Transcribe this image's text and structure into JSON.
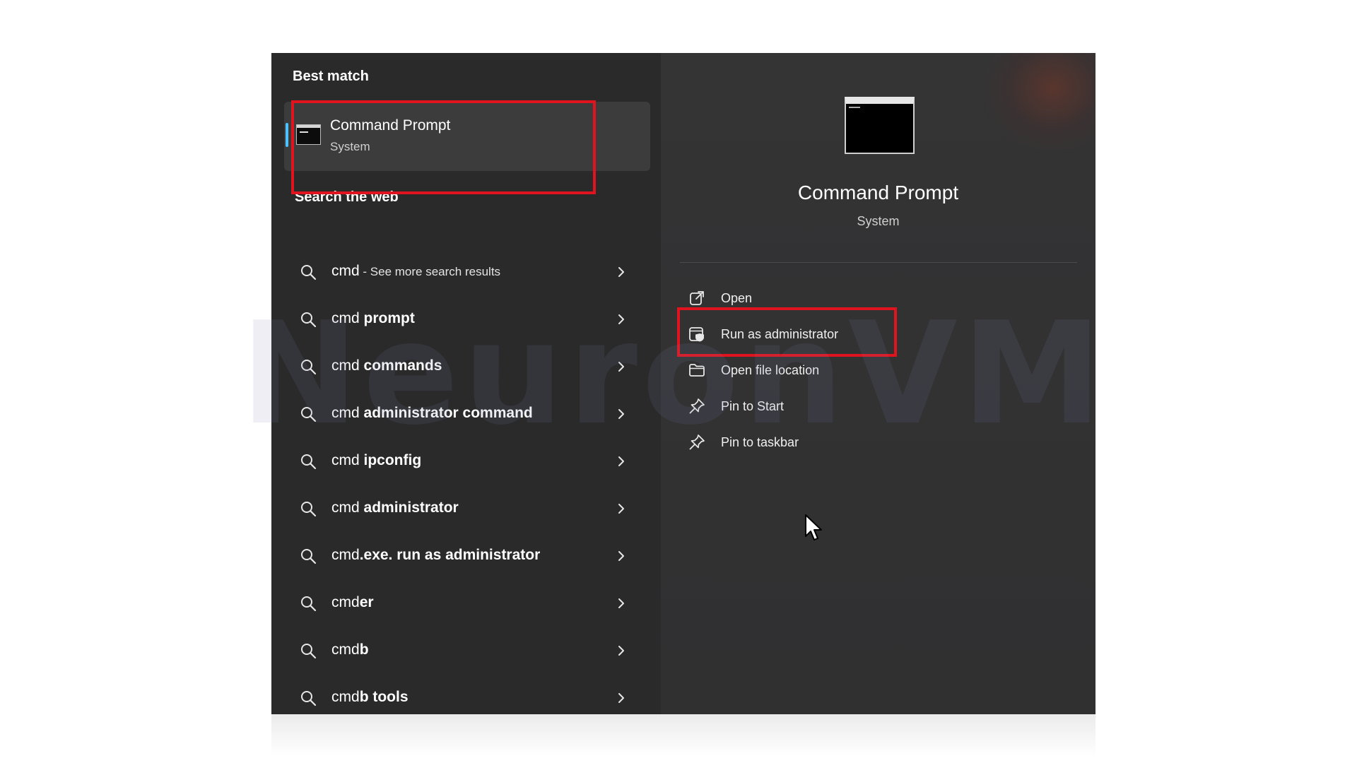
{
  "left": {
    "best_match_title": "Best match",
    "best_match": {
      "name": "Command Prompt",
      "subtitle": "System",
      "icon": "cmd-icon"
    },
    "search_web_title": "Search the web",
    "web_results": [
      {
        "prefix": "cmd",
        "bold": "",
        "note": " - See more search results",
        "icon": "search-icon"
      },
      {
        "prefix": "cmd ",
        "bold": "prompt",
        "note": "",
        "icon": "search-icon"
      },
      {
        "prefix": "cmd ",
        "bold": "commands",
        "note": "",
        "icon": "search-icon"
      },
      {
        "prefix": "cmd ",
        "bold": "administrator command",
        "note": "",
        "icon": "search-icon"
      },
      {
        "prefix": "cmd ",
        "bold": "ipconfig",
        "note": "",
        "icon": "search-icon"
      },
      {
        "prefix": "cmd ",
        "bold": "administrator",
        "note": "",
        "icon": "search-icon"
      },
      {
        "prefix": "cmd",
        "bold": ".exe. run as administrator",
        "note": "",
        "icon": "search-icon"
      },
      {
        "prefix": "cmd",
        "bold": "er",
        "note": "",
        "icon": "search-icon"
      },
      {
        "prefix": "cmd",
        "bold": "b",
        "note": "",
        "icon": "search-icon"
      },
      {
        "prefix": "cmd",
        "bold": "b tools",
        "note": "",
        "icon": "search-icon"
      }
    ]
  },
  "right": {
    "app_name": "Command Prompt",
    "app_subtitle": "System",
    "actions": [
      {
        "label": "Open",
        "icon": "open-external-icon"
      },
      {
        "label": "Run as administrator",
        "icon": "shield-admin-icon"
      },
      {
        "label": "Open file location",
        "icon": "folder-icon"
      },
      {
        "label": "Pin to Start",
        "icon": "pin-icon"
      },
      {
        "label": "Pin to taskbar",
        "icon": "pin-icon"
      }
    ]
  },
  "watermark": "NeuronVM",
  "colors": {
    "panel_left": "#2a2a2b",
    "panel_right": "#323233",
    "accent": "#4cc2ff",
    "highlight_red": "#e0141e",
    "text": "#ffffff"
  }
}
